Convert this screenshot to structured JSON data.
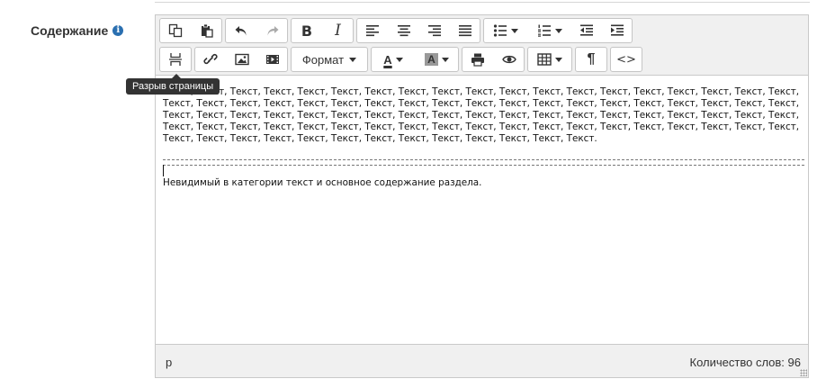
{
  "form": {
    "content_label": "Содержание",
    "info_icon_glyph": "i"
  },
  "toolbar": {
    "row1": [
      {
        "name": "copy-button",
        "icon": "copy-icon"
      },
      {
        "name": "paste-button",
        "icon": "paste-icon"
      },
      {
        "name": "undo-button",
        "icon": "undo-icon"
      },
      {
        "name": "redo-button",
        "icon": "redo-icon",
        "disabled": true
      },
      {
        "name": "bold-button",
        "label": "B"
      },
      {
        "name": "italic-button",
        "label": "I"
      },
      {
        "name": "align-left-button",
        "icon": "align-left-icon"
      },
      {
        "name": "align-center-button",
        "icon": "align-center-icon"
      },
      {
        "name": "align-right-button",
        "icon": "align-right-icon"
      },
      {
        "name": "align-justify-button",
        "icon": "align-justify-icon"
      },
      {
        "name": "bullet-list-button",
        "icon": "bullet-list-icon"
      },
      {
        "name": "numbered-list-button",
        "icon": "numbered-list-icon"
      },
      {
        "name": "outdent-button",
        "icon": "outdent-icon"
      },
      {
        "name": "indent-button",
        "icon": "indent-icon"
      }
    ],
    "format_label": "Формат",
    "text_color_label": "A",
    "bg_color_label": "A",
    "pilcrow_label": "¶",
    "code_label": "<>"
  },
  "tooltip": {
    "text": "Разрыв страницы"
  },
  "editor": {
    "body_text": "Текст, Текст, Текст, Текст, Текст, Текст, Текст, Текст, Текст, Текст, Текст, Текст, Текст, Текст, Текст, Текст, Текст, Текст, Текст, Текст, Текст, Текст, Текст, Текст, Текст, Текст, Текст, Текст, Текст, Текст, Текст, Текст, Текст, Текст, Текст, Текст, Текст, Текст, Текст, Текст, Текст, Текст, Текст, Текст, Текст, Текст, Текст, Текст, Текст, Текст, Текст, Текст, Текст, Текст, Текст, Текст, Текст, Текст, Текст, Текст, Текст, Текст, Текст, Текст, Текст, Текст, Текст, Текст, Текст, Текст, Текст, Текст, Текст, Текст, Текст, Текст, Текст, Текст, Текст, Текст, Текст, Текст, Текст, Текст, Текст, Текст, Текст, Текст, Текст.",
    "hidden_text": "Невидимый в категории текст и основное содержание раздела."
  },
  "statusbar": {
    "path": "p",
    "word_count": "Количество слов: 96"
  },
  "colors": {
    "toolbar_bg": "#f0f0f0",
    "border": "#c9c9c9",
    "tooltip_bg": "#333333",
    "info_icon": "#2a6fb0"
  }
}
